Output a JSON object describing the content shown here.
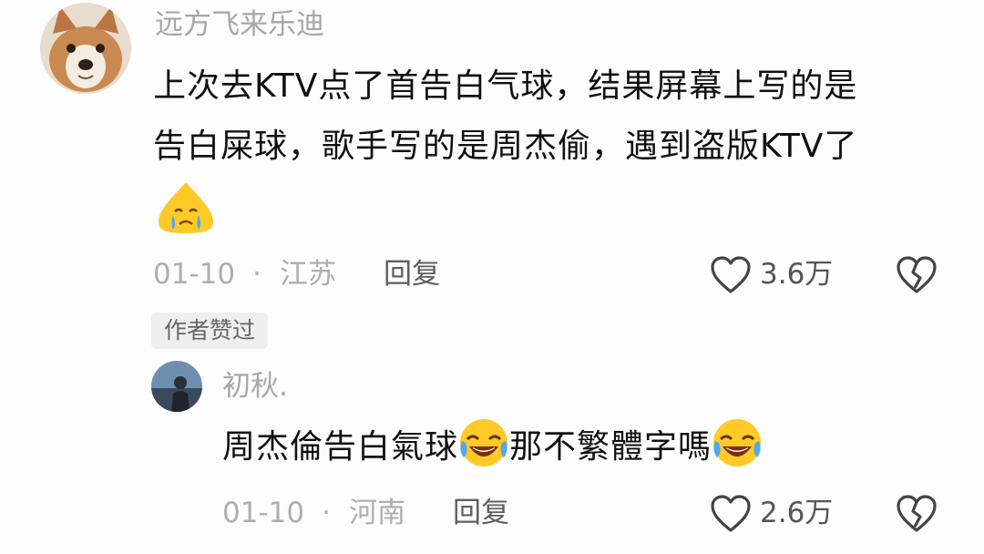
{
  "comment": {
    "username": "远方飞来乐迪",
    "text_line1": "上次去KTV点了首告白气球，结果屏幕上写的是",
    "text_line2": "告白屎球，歌手写的是周杰偷，遇到盗版KTV了",
    "emoji": "crying-face-emoji",
    "date": "01-10",
    "separator": "·",
    "location": "江苏",
    "reply_label": "回复",
    "like_count": "3.6万",
    "author_badge": "作者赞过"
  },
  "reply": {
    "username": "初秋.",
    "text_part1": "周杰倫告白氣球",
    "text_part2": "那不繁體字嗎",
    "emoji": "laughing-crying-face-emoji",
    "date": "01-10",
    "separator": "·",
    "location": "河南",
    "reply_label": "回复",
    "like_count": "2.6万"
  },
  "icons": {
    "like": "heart-outline-icon",
    "dislike": "broken-heart-icon"
  }
}
